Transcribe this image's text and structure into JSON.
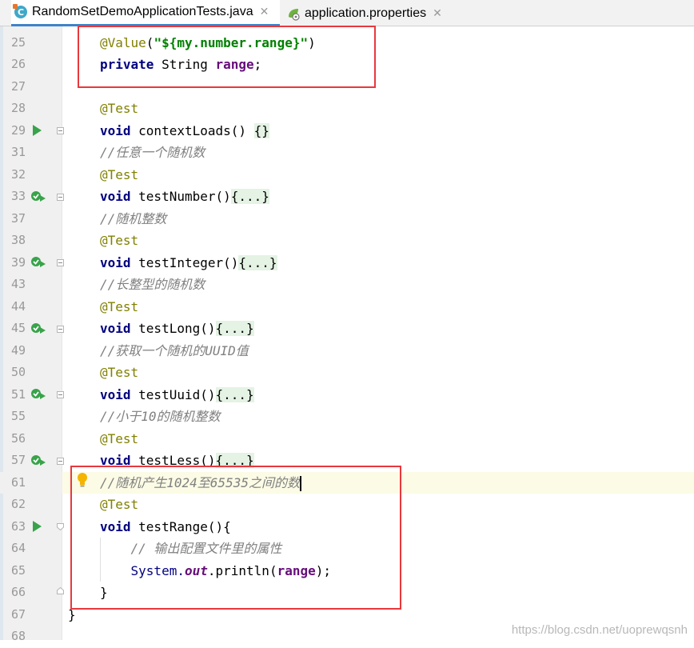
{
  "tabs": [
    {
      "label": "RandomSetDemoApplicationTests.java",
      "icon": "java-class-icon",
      "active": true
    },
    {
      "label": "application.properties",
      "icon": "spring-properties-icon",
      "active": false
    }
  ],
  "lines": [
    {
      "num": "25",
      "tokens": [
        [
          "ann",
          "@Value"
        ],
        [
          "",
          "("
        ],
        [
          "str",
          "\"${my.number.range}\""
        ],
        [
          "",
          ")"
        ]
      ]
    },
    {
      "num": "26",
      "tokens": [
        [
          "kw",
          "private"
        ],
        [
          "",
          " String "
        ],
        [
          "field",
          "range"
        ],
        [
          "",
          ";"
        ]
      ]
    },
    {
      "num": "27",
      "tokens": []
    },
    {
      "num": "28",
      "tokens": [
        [
          "ann",
          "@Test"
        ]
      ]
    },
    {
      "num": "29",
      "tokens": [
        [
          "kw",
          "void"
        ],
        [
          "",
          " contextLoads() "
        ],
        [
          "fold",
          "{}"
        ]
      ]
    },
    {
      "num": "31",
      "tokens": [
        [
          "cmt",
          "//任意一个随机数"
        ]
      ]
    },
    {
      "num": "32",
      "tokens": [
        [
          "ann",
          "@Test"
        ]
      ]
    },
    {
      "num": "33",
      "tokens": [
        [
          "kw",
          "void"
        ],
        [
          "",
          " testNumber()"
        ],
        [
          "fold",
          "{...}"
        ]
      ]
    },
    {
      "num": "37",
      "tokens": [
        [
          "cmt",
          "//随机整数"
        ]
      ]
    },
    {
      "num": "38",
      "tokens": [
        [
          "ann",
          "@Test"
        ]
      ]
    },
    {
      "num": "39",
      "tokens": [
        [
          "kw",
          "void"
        ],
        [
          "",
          " testInteger()"
        ],
        [
          "fold",
          "{...}"
        ]
      ]
    },
    {
      "num": "43",
      "tokens": [
        [
          "cmt",
          "//长整型的随机数"
        ]
      ]
    },
    {
      "num": "44",
      "tokens": [
        [
          "ann",
          "@Test"
        ]
      ]
    },
    {
      "num": "45",
      "tokens": [
        [
          "kw",
          "void"
        ],
        [
          "",
          " testLong()"
        ],
        [
          "fold",
          "{...}"
        ]
      ]
    },
    {
      "num": "49",
      "tokens": [
        [
          "cmt",
          "//获取一个随机的UUID值"
        ]
      ]
    },
    {
      "num": "50",
      "tokens": [
        [
          "ann",
          "@Test"
        ]
      ]
    },
    {
      "num": "51",
      "tokens": [
        [
          "kw",
          "void"
        ],
        [
          "",
          " testUuid()"
        ],
        [
          "fold",
          "{...}"
        ]
      ]
    },
    {
      "num": "55",
      "tokens": [
        [
          "cmt",
          "//小于10的随机整数"
        ]
      ]
    },
    {
      "num": "56",
      "tokens": [
        [
          "ann",
          "@Test"
        ]
      ]
    },
    {
      "num": "57",
      "tokens": [
        [
          "kw",
          "void"
        ],
        [
          "",
          " testLess()"
        ],
        [
          "fold",
          "{...}"
        ]
      ]
    },
    {
      "num": "61",
      "tokens": [
        [
          "cmt",
          "//随机产生1024至65535之间的数"
        ]
      ],
      "current": true
    },
    {
      "num": "62",
      "tokens": [
        [
          "ann",
          "@Test"
        ]
      ]
    },
    {
      "num": "63",
      "tokens": [
        [
          "kw",
          "void"
        ],
        [
          "",
          " testRange(){"
        ]
      ]
    },
    {
      "num": "64",
      "tokens": [
        [
          "",
          "    "
        ],
        [
          "cmt",
          "// 输出配置文件里的属性"
        ]
      ]
    },
    {
      "num": "65",
      "tokens": [
        [
          "",
          "    "
        ],
        [
          "sys",
          "System."
        ],
        [
          "out",
          "out"
        ],
        [
          "",
          ".println("
        ],
        [
          "field",
          "range"
        ],
        [
          "",
          ");"
        ]
      ]
    },
    {
      "num": "66",
      "tokens": [
        [
          "",
          "}"
        ]
      ]
    },
    {
      "num": "67",
      "tokens": [
        [
          "",
          "}"
        ]
      ],
      "outdent": true
    },
    {
      "num": "68",
      "tokens": []
    }
  ],
  "watermark": "https://blog.csdn.net/uoprewqsnh"
}
